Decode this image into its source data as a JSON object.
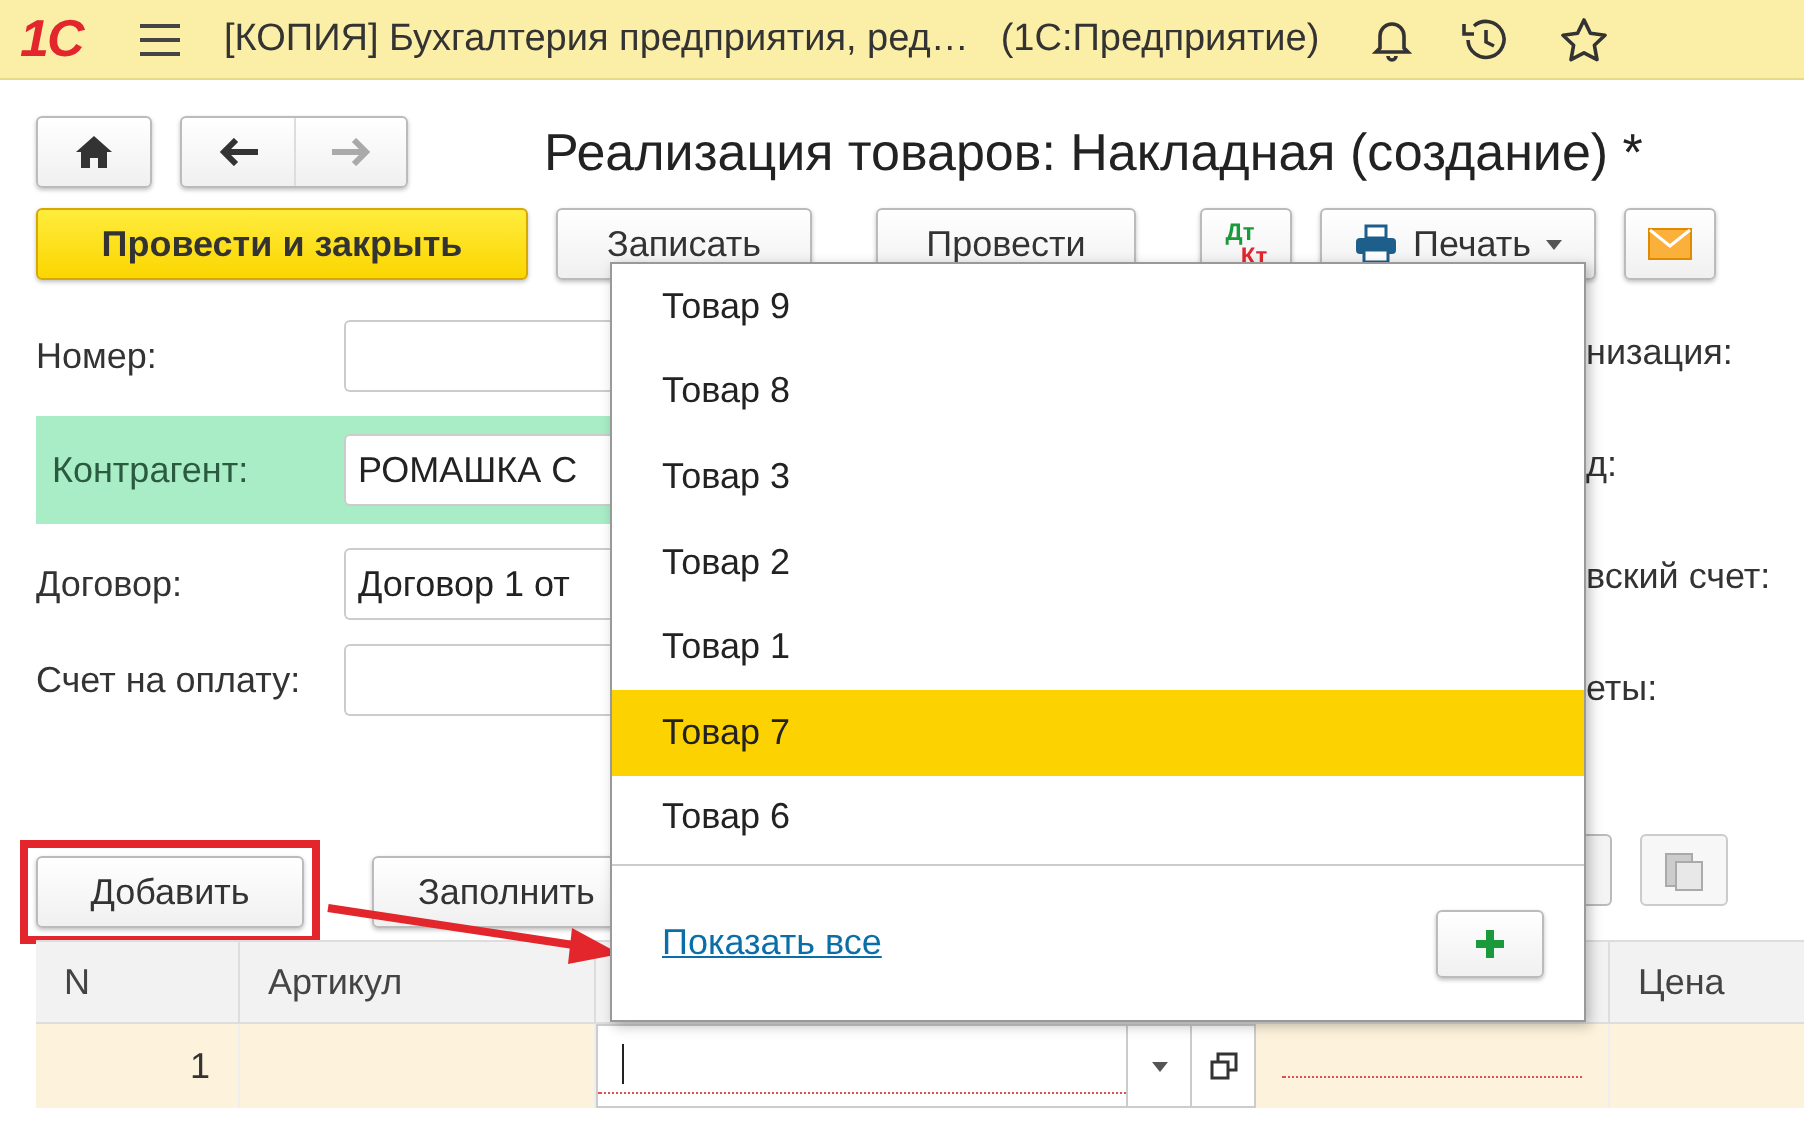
{
  "app": {
    "logo": "1С",
    "title": "[КОПИЯ] Бухгалтерия предприятия, ред…",
    "subtitle": "(1С:Предприятие)"
  },
  "document_title": "Реализация товаров: Накладная (создание) *",
  "commands": [
    {
      "kind": "primary",
      "label": "Провести и закрыть"
    },
    {
      "kind": "plain",
      "label": "Записать"
    },
    {
      "kind": "plain",
      "label": "Провести"
    },
    {
      "kind": "dtkt",
      "label": "Дт",
      "sublabel": "Кт"
    },
    {
      "kind": "print",
      "label": "Печать"
    },
    {
      "kind": "mail"
    }
  ],
  "fields": [
    {
      "label": "Номер:",
      "highlighted": false
    },
    {
      "label": "Контрагент:",
      "value": "РОМАШКА С",
      "highlighted": true
    },
    {
      "label": "Договор:",
      "value": "Договор 1 от",
      "highlighted": false
    },
    {
      "label": "Счет на оплату:",
      "highlighted": false
    }
  ],
  "right_labels": [
    "низация:",
    "д:",
    "вский счет:",
    "еты:"
  ],
  "table_buttons": [
    {
      "label": "Добавить",
      "marked": true
    },
    {
      "label": "Заполнить",
      "marked": false
    }
  ],
  "table": {
    "columns": [
      "N",
      "Артикул",
      "Цена"
    ],
    "rows": [
      {
        "n": "1"
      }
    ]
  },
  "dropdown": {
    "items": [
      {
        "label": "Товар 9",
        "selected": false
      },
      {
        "label": "Товар 8",
        "selected": false
      },
      {
        "label": "Товар 3",
        "selected": false
      },
      {
        "label": "Товар 2",
        "selected": false
      },
      {
        "label": "Товар 1",
        "selected": false
      },
      {
        "label": "Товар 7",
        "selected": true
      },
      {
        "label": "Товар 6",
        "selected": false
      }
    ],
    "show_all": "Показать все"
  }
}
